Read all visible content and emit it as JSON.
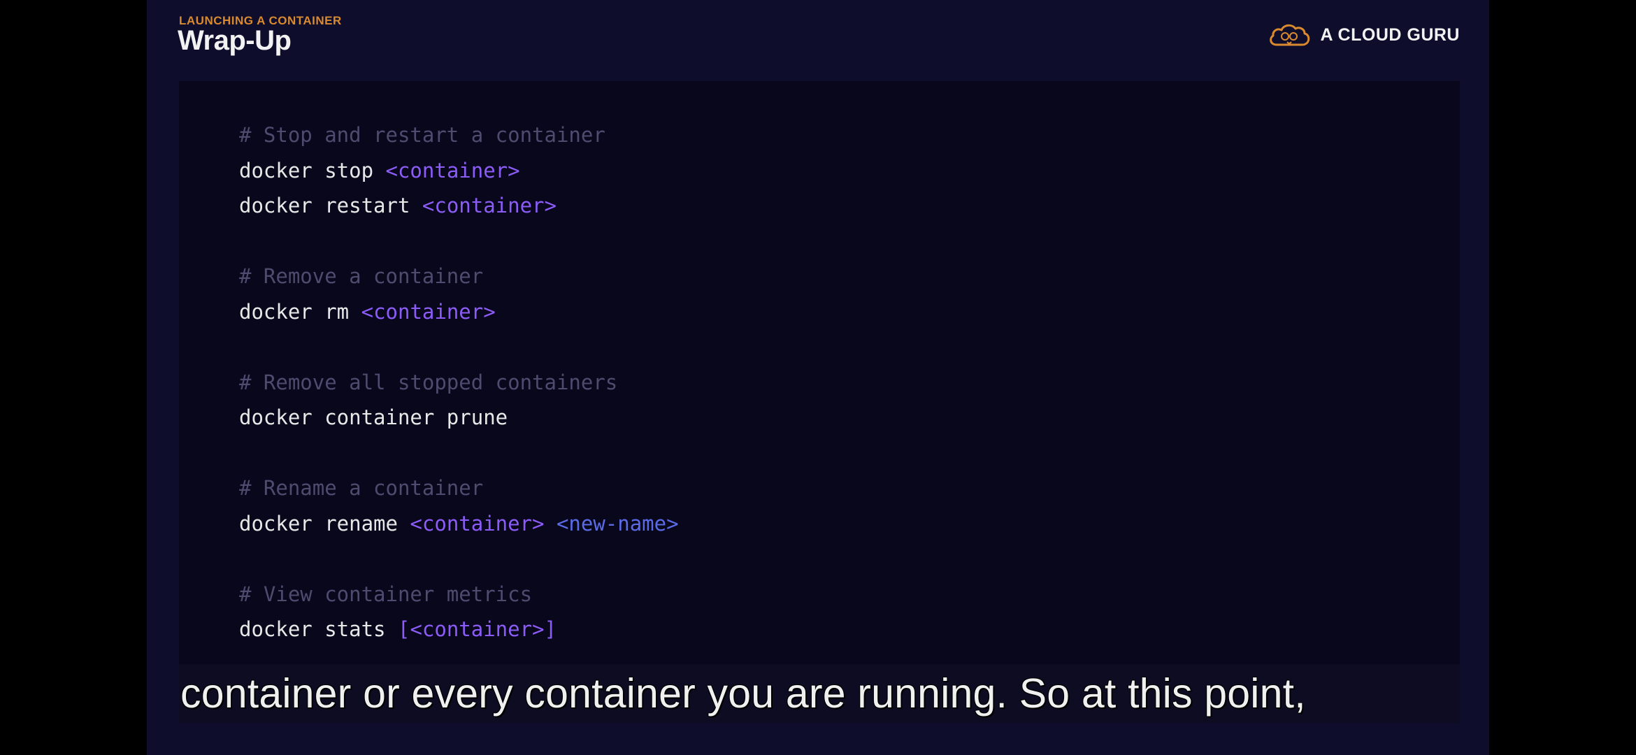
{
  "header": {
    "kicker": "LAUNCHING A CONTAINER",
    "title": "Wrap-Up"
  },
  "brand": {
    "name": "A CLOUD GURU",
    "logo_icon": "cloud-guru-logo-icon",
    "logo_color": "#d98a2f"
  },
  "code": {
    "comment_color": "#4d4b6e",
    "arg_color": "#8b5cf6",
    "arg2_color": "#5b6be6",
    "lines": [
      {
        "comment": "# Stop and restart a container"
      },
      {
        "cmd": "docker stop ",
        "arg": "<container>"
      },
      {
        "cmd": "docker restart ",
        "arg": "<container>"
      },
      {
        "blank": ""
      },
      {
        "comment": "# Remove a container"
      },
      {
        "cmd": "docker rm ",
        "arg": "<container>"
      },
      {
        "blank": ""
      },
      {
        "comment": "# Remove all stopped containers"
      },
      {
        "cmd": "docker container prune"
      },
      {
        "blank": ""
      },
      {
        "comment": "# Rename a container"
      },
      {
        "cmd": "docker rename ",
        "arg": "<container>",
        "sep": " ",
        "arg2": "<new-name>"
      },
      {
        "blank": ""
      },
      {
        "comment": "# View container metrics"
      },
      {
        "cmd": "docker stats ",
        "arg": "[<container>]"
      }
    ]
  },
  "subtitle": {
    "text": "container or every container you are running. So at this point,"
  }
}
